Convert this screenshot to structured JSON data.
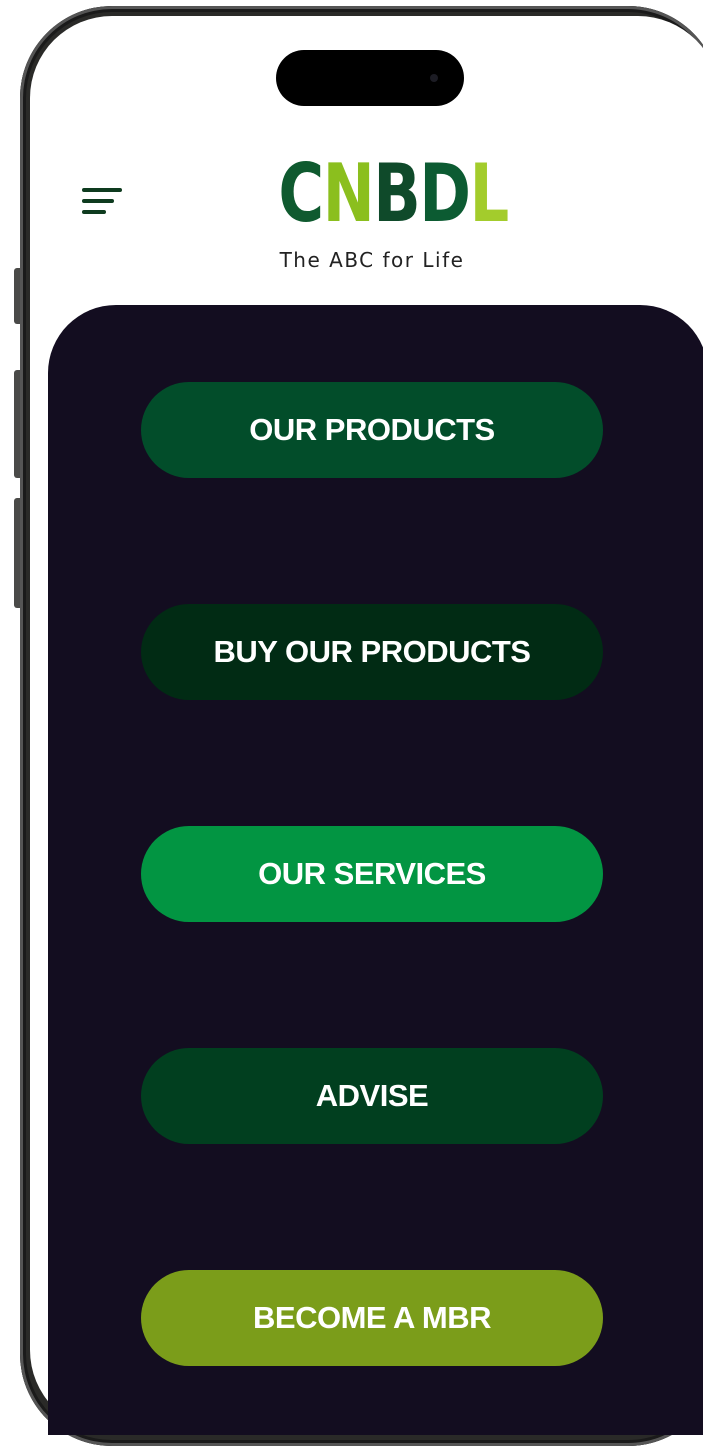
{
  "brand": {
    "logo_letters": [
      "C",
      "N",
      "B",
      "D",
      "L"
    ],
    "tagline": "The ABC for Life",
    "colors": {
      "dark_green": "#0f5a2f",
      "lime": "#a3cc2c",
      "panel_bg": "#130d20"
    }
  },
  "header": {
    "menu_icon": "hamburger-menu-icon"
  },
  "menu": {
    "items": [
      {
        "label": "OUR PRODUCTS",
        "color": "#024d2a"
      },
      {
        "label": "BUY OUR PRODUCTS",
        "color": "#012b14"
      },
      {
        "label": "OUR SERVICES",
        "color": "#029542"
      },
      {
        "label": "ADVISE",
        "color": "#013f1f"
      },
      {
        "label": "BECOME A MBR",
        "color": "#7b9d1a"
      }
    ]
  }
}
